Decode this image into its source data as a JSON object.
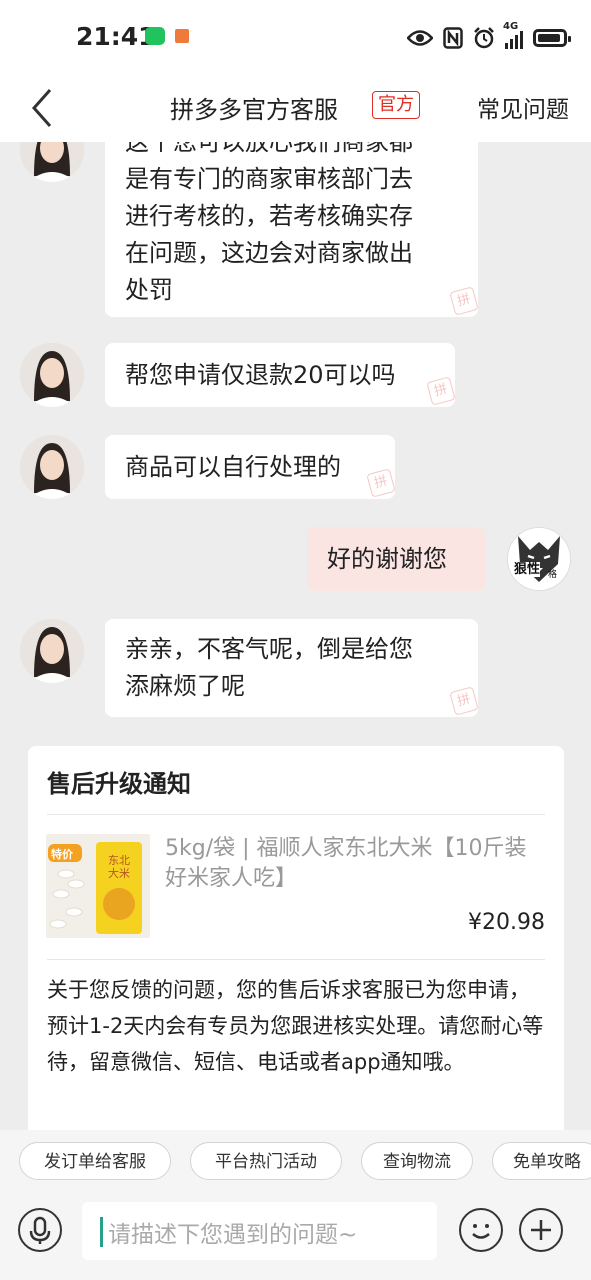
{
  "status": {
    "time": "21:41",
    "network": "4G"
  },
  "header": {
    "title": "拼多多官方客服",
    "badge": "官方",
    "faq": "常见问题"
  },
  "messages": [
    {
      "side": "agent",
      "lines": [
        "这个您可以放心我们商家都",
        "是有专门的商家审核部门去",
        "进行考核的，若考核确实存",
        "在问题，这边会对商家做出",
        "处罚"
      ]
    },
    {
      "side": "agent",
      "lines": [
        "帮您申请仅退款20可以吗"
      ]
    },
    {
      "side": "agent",
      "lines": [
        "商品可以自行处理的"
      ]
    },
    {
      "side": "user",
      "lines": [
        "好的谢谢您"
      ]
    },
    {
      "side": "agent",
      "lines": [
        "亲亲，不客气呢，倒是给您",
        "添麻烦了呢"
      ]
    }
  ],
  "watermark": "拼",
  "user_avatar_text": [
    "狠性",
    "格"
  ],
  "card": {
    "title": "售后升级通知",
    "product_name": "5kg/袋 | 福顺人家东北大米【10斤装好米家人吃】",
    "price": "¥20.98",
    "product_badge": "特价",
    "product_pack_text": "东北大米",
    "body": "关于您反馈的问题，您的售后诉求客服已为您申请，预计1-2天内会有专员为您跟进核实处理。请您耐心等待，留意微信、短信、电话或者app通知哦。"
  },
  "quick_actions": [
    "发订单给客服",
    "平台热门活动",
    "查询物流",
    "免单攻略"
  ],
  "input": {
    "placeholder": "请描述下您遇到的问题~"
  },
  "colors": {
    "brand_red": "#e02e24",
    "user_bubble": "#fbe5e2",
    "background": "#ededed"
  },
  "icons": [
    "back-arrow-icon",
    "eye-icon",
    "nfc-icon",
    "alarm-icon",
    "signal-icon",
    "battery-icon",
    "wechat-icon",
    "book-icon",
    "microphone-icon",
    "emoji-icon",
    "plus-icon"
  ]
}
